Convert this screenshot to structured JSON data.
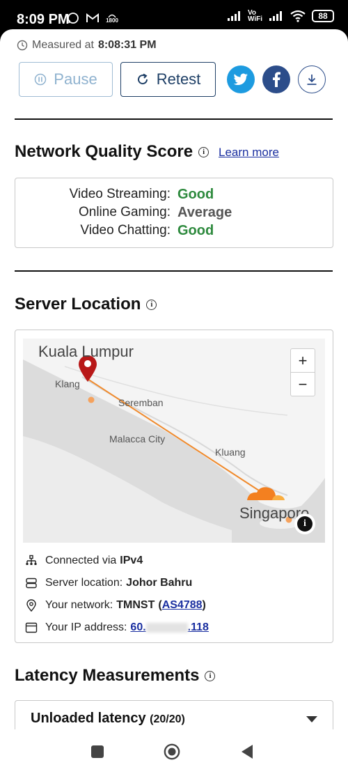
{
  "status_bar": {
    "time": "8:09 PM",
    "network_badge": "1800",
    "wifi_label": "Vo\nWiFi",
    "battery": "88"
  },
  "measured": {
    "prefix": "Measured at",
    "time": "8:08:31 PM"
  },
  "actions": {
    "pause_label": "Pause",
    "retest_label": "Retest"
  },
  "network_quality": {
    "title": "Network Quality Score",
    "learn_more": "Learn more",
    "rows": [
      {
        "label": "Video Streaming:",
        "value": "Good"
      },
      {
        "label": "Online Gaming:",
        "value": "Average"
      },
      {
        "label": "Video Chatting:",
        "value": "Good"
      }
    ]
  },
  "server_location": {
    "title": "Server Location",
    "map": {
      "labels": [
        "Kuala Lumpur",
        "Klang",
        "Seremban",
        "Malacca City",
        "Kluang",
        "Singapore"
      ],
      "zoom_in": "+",
      "zoom_out": "−"
    },
    "details": {
      "connected_prefix": "Connected via",
      "connected_value": "IPv4",
      "server_prefix": "Server location:",
      "server_value": "Johor Bahru",
      "network_prefix": "Your network:",
      "network_name": "TMNST",
      "network_asn": "AS4788",
      "ip_prefix": "Your IP address:",
      "ip_start": "60.",
      "ip_end": ".118"
    }
  },
  "latency": {
    "title": "Latency Measurements",
    "unloaded_label": "Unloaded latency",
    "unloaded_count": "(20/20)"
  },
  "colors": {
    "good": "#2e8a3e",
    "accent": "#1e3f66",
    "twitter": "#1d9be0",
    "facebook": "#2c4d8a",
    "route": "#f08a2c",
    "pin": "#b81818"
  }
}
